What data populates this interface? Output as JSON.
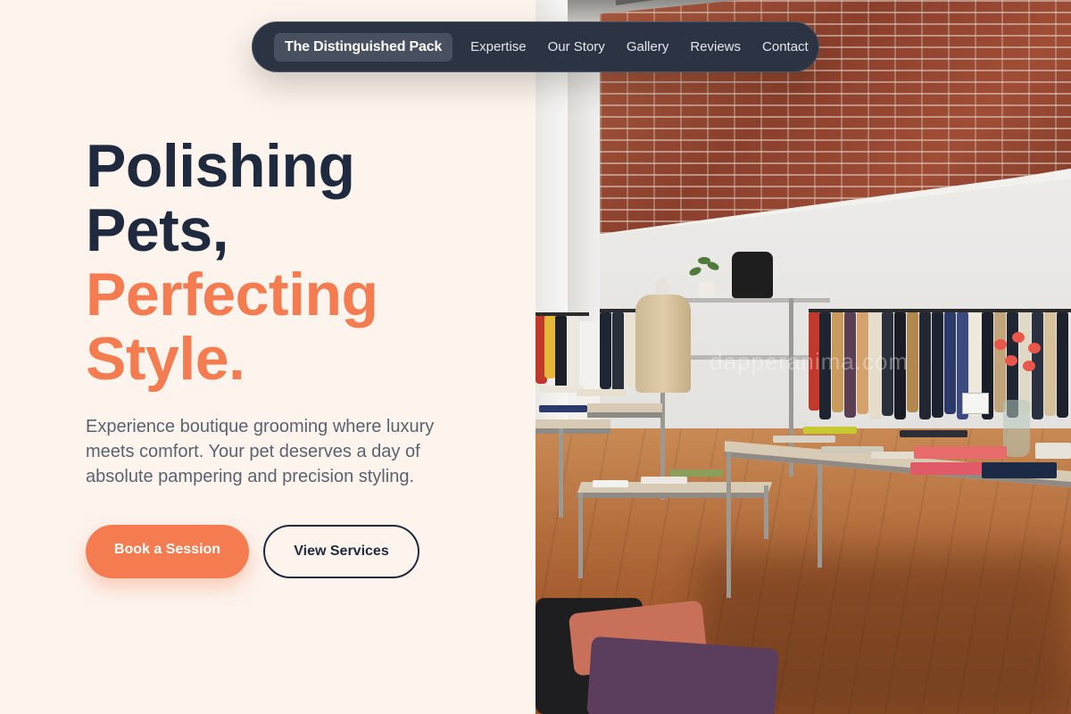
{
  "nav": {
    "brand": "The Distinguished Pack",
    "links": [
      "Expertise",
      "Our Story",
      "Gallery",
      "Reviews",
      "Contact"
    ]
  },
  "hero": {
    "headline_line1": "Polishing",
    "headline_line2": "Pets,",
    "headline_line3": "Perfecting",
    "headline_line4": "Style.",
    "subtext": "Experience boutique grooming where luxury meets comfort. Your pet deserves a day of absolute pampering and precision styling.",
    "primary_button": "Book a Session",
    "secondary_button": "View Services"
  },
  "image": {
    "watermark": "dapperanima.com"
  },
  "colors": {
    "background": "#fdf4ee",
    "nav_background": "#2c3444",
    "heading_dark": "#1f2a3e",
    "accent": "#f47c50",
    "body_text": "#5c6270"
  }
}
